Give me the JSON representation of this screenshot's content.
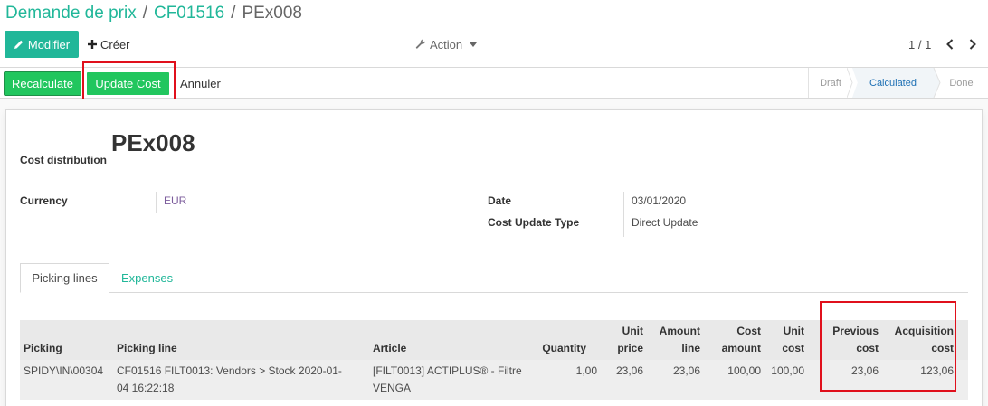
{
  "breadcrumb": {
    "items": [
      "Demande de prix",
      "CF01516"
    ],
    "current": "PEx008",
    "separator": "/"
  },
  "toolbar": {
    "edit_label": "Modifier",
    "create_label": "Créer",
    "action_label": "Action",
    "pager_text": "1 / 1"
  },
  "statusbar": {
    "buttons": [
      "Recalculate",
      "Update Cost"
    ],
    "cancel_label": "Annuler",
    "stages": [
      "Draft",
      "Calculated",
      "Done"
    ],
    "active_stage": "Calculated"
  },
  "form": {
    "title": "PEx008",
    "subtitle_label": "Cost distribution",
    "currency_label": "Currency",
    "currency_value": "EUR",
    "date_label": "Date",
    "date_value": "03/01/2020",
    "cost_update_type_label": "Cost Update Type",
    "cost_update_type_value": "Direct Update"
  },
  "tabs": [
    "Picking lines",
    "Expenses"
  ],
  "table": {
    "columns": [
      [
        "Picking"
      ],
      [
        "Picking line"
      ],
      [
        "Article"
      ],
      [
        "Quantity"
      ],
      [
        "Unit",
        "price"
      ],
      [
        "Amount",
        "line"
      ],
      [
        "Cost",
        "amount"
      ],
      [
        "Unit",
        "cost"
      ],
      [
        "Previous",
        "cost"
      ],
      [
        "Acquisition",
        "cost"
      ]
    ],
    "rows": [
      {
        "picking": "SPIDY\\IN\\00304",
        "picking_line": [
          "CF01516 FILT0013: Vendors > Stock 2020-01-",
          "04 16:22:18"
        ],
        "article": [
          "[FILT0013] ACTIPLUS® - Filtre",
          "VENGA"
        ],
        "quantity": "1,00",
        "unit_price": "23,06",
        "amount_line": "23,06",
        "cost_amount": "100,00",
        "unit_cost": "100,00",
        "previous_cost": "23,06",
        "acquisition_cost": "123,06"
      }
    ]
  },
  "icons": {
    "edit": "pencil-icon",
    "create": "plus-icon",
    "action": "wrench-icon",
    "pager_prev": "chevron-left-icon",
    "pager_next": "chevron-right-icon"
  },
  "colors": {
    "brand": "#21b799",
    "status_button": "#21c65e",
    "active_stage_text": "#1c6fb4",
    "annotation_box": "#e0101c"
  }
}
